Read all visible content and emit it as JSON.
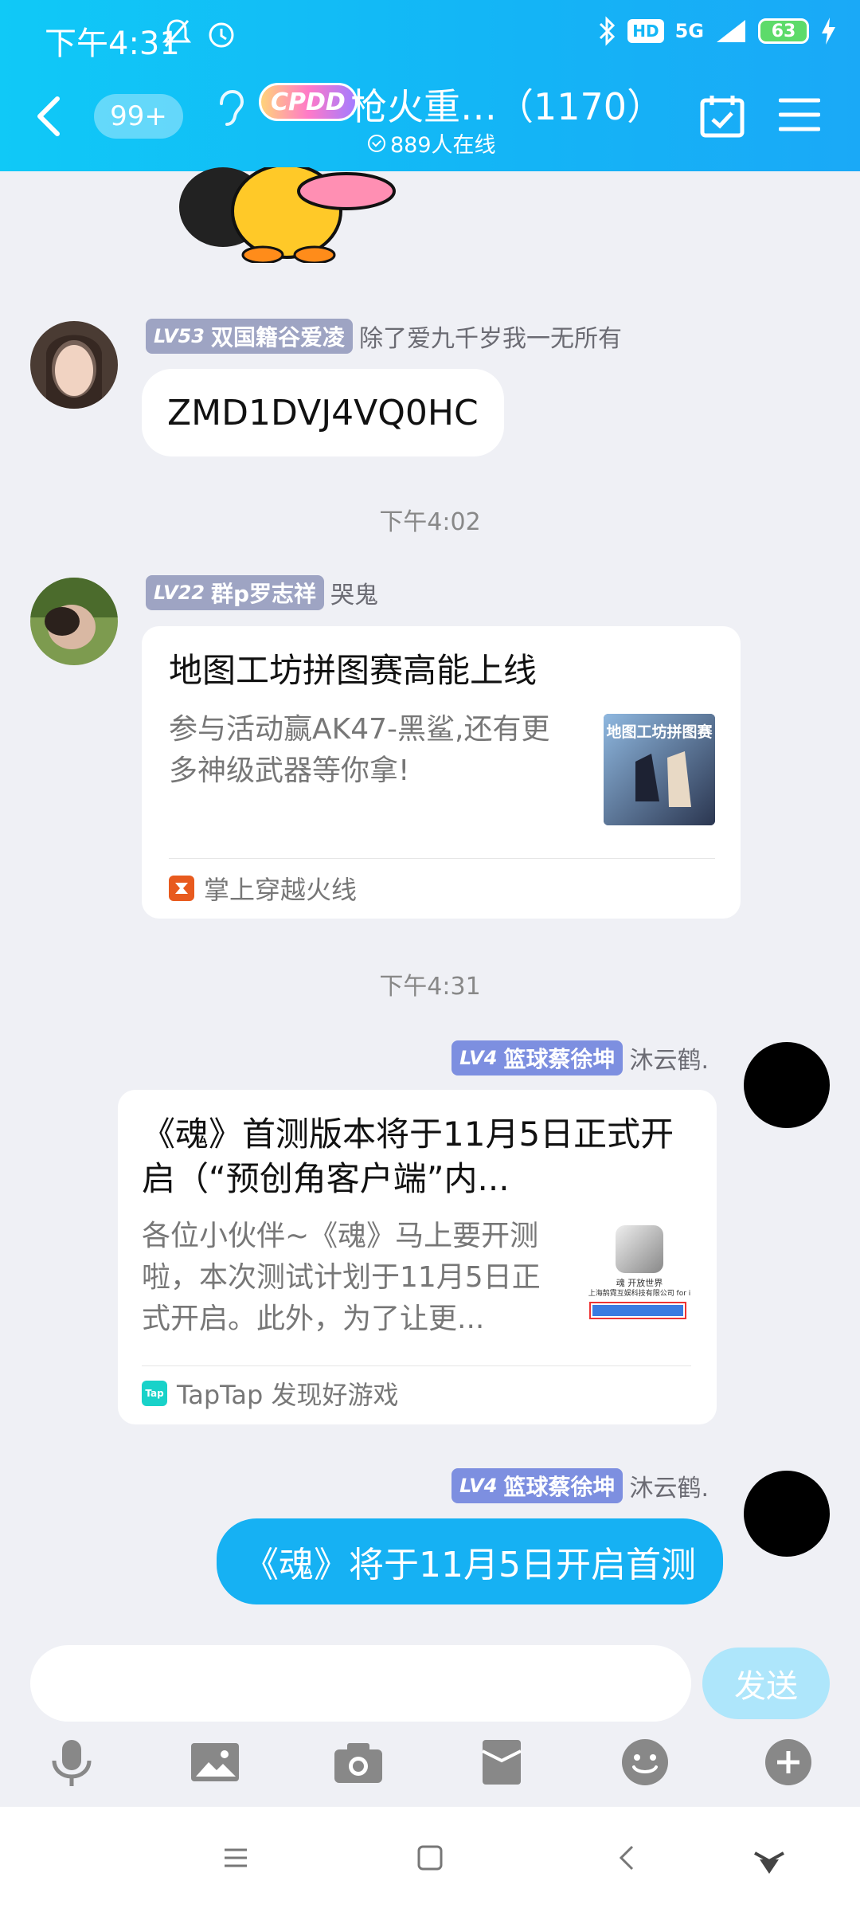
{
  "status_bar": {
    "time": "下午4:31",
    "battery": "63",
    "network": "5G",
    "hd": "HD"
  },
  "header": {
    "unread_badge": "99+",
    "tag": "CPDD",
    "group_title": "枪火重…（1170）",
    "online": "889人在线"
  },
  "messages": [
    {
      "level": "LV53",
      "title": "双国籍谷爱凌",
      "nickname": "除了爱九千岁我一无所有",
      "text": "ZMD1DVJ4VQ0HC"
    },
    {
      "timestamp": "下午4:02"
    },
    {
      "level": "LV22",
      "title": "群p罗志祥",
      "nickname": "哭鬼",
      "card": {
        "title": "地图工坊拼图赛高能上线",
        "desc": "参与活动赢AK47-黑鲨,还有更多神级武器等你拿!",
        "thumb_text": "地图工坊拼图赛",
        "source": "掌上穿越火线"
      }
    },
    {
      "timestamp": "下午4:31"
    },
    {
      "level": "LV4",
      "title": "篮球蔡徐坤",
      "nickname": "沐云鹤.",
      "card": {
        "title": "《魂》首测版本将于11月5日正式开启（“预创角客户端”内...",
        "desc": "各位小伙伴~《魂》马上要开测啦，本次测试计划于11月5日正式开启。此外，为了让更...",
        "thumb_line1": "魂 开放世界",
        "thumb_line2": "上海鹄霓互娱科技有限公司 for i",
        "source": "TapTap 发现好游戏",
        "source_icon_text": "Tap"
      }
    },
    {
      "level": "LV4",
      "title": "篮球蔡徐坤",
      "nickname": "沐云鹤.",
      "text": "《魂》将于11月5日开启首测"
    }
  ],
  "input": {
    "placeholder": "",
    "send_label": "发送"
  },
  "colors": {
    "header": "#13b6f6",
    "bubble_self": "#16b1f3",
    "background": "#eff0f5"
  }
}
